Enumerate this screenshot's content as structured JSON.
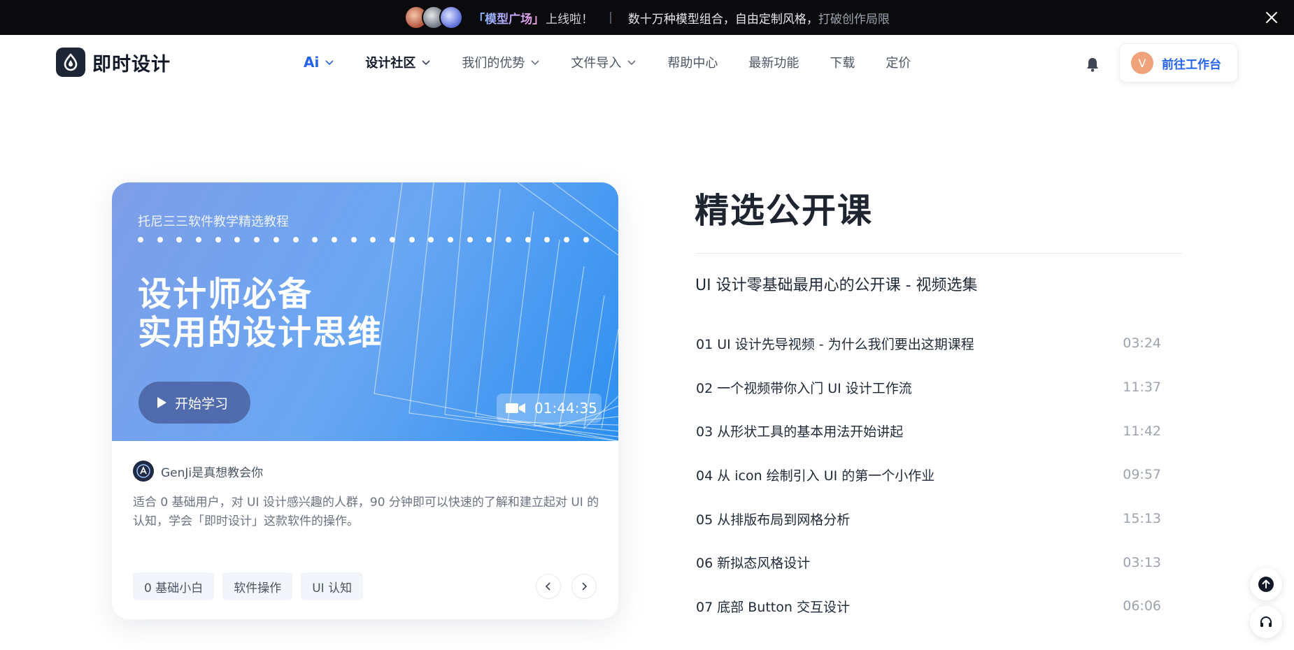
{
  "announcement": {
    "highlight": "「模型广场」",
    "launched": "上线啦！",
    "separator": "|",
    "desc_main": "数十万种模型组合，自由定制风格，",
    "desc_fade": "打破创作局限"
  },
  "logo": {
    "text": "即时设计"
  },
  "nav": {
    "ai": "Ai",
    "community": "设计社区",
    "advantages": "我们的优势",
    "import": "文件导入",
    "help": "帮助中心",
    "features": "最新功能",
    "download": "下载",
    "pricing": "定价"
  },
  "workspace": {
    "avatar_letter": "V",
    "label": "前往工作台"
  },
  "card": {
    "subtitle": "托尼三三软件教学精选教程",
    "title_line1": "设计师必备",
    "title_line2": "实用的设计思维",
    "start_label": "开始学习",
    "duration": "01:44:35",
    "author": "GenJi是真想教会你",
    "blurb": "适合 0 基础用户，对 UI 设计感兴趣的人群，90 分钟即可以快速的了解和建立起对 UI 的认知，学会「即时设计」这款软件的操作。",
    "tags": [
      "0 基础小白",
      "软件操作",
      "UI 认知"
    ]
  },
  "section": {
    "title": "精选公开课",
    "subtitle": "UI 设计零基础最用心的公开课 - 视频选集"
  },
  "lessons": [
    {
      "title": "01 UI 设计先导视频 - 为什么我们要出这期课程",
      "time": "03:24"
    },
    {
      "title": "02 一个视频带你入门 UI 设计工作流",
      "time": "11:37"
    },
    {
      "title": "03 从形状工具的基本用法开始讲起",
      "time": "11:42"
    },
    {
      "title": "04 从 icon 绘制引入 UI 的第一个小作业",
      "time": "09:57"
    },
    {
      "title": "05 从排版布局到网格分析",
      "time": "15:13"
    },
    {
      "title": "06 新拟态风格设计",
      "time": "03:13"
    },
    {
      "title": "07 底部 Button 交互设计",
      "time": "06:06"
    }
  ]
}
